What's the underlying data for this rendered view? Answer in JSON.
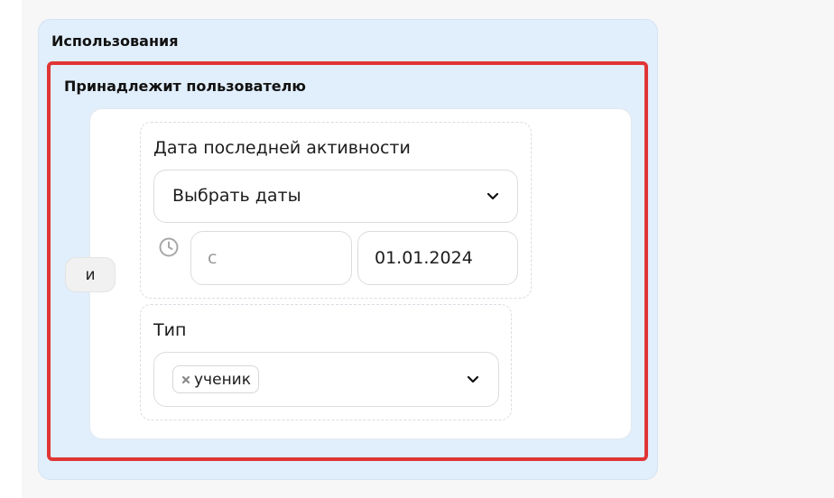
{
  "usage": {
    "title": "Использования",
    "owner_group": {
      "title": "Принадлежит пользователю",
      "operator_label": "и",
      "filters": {
        "last_activity": {
          "label": "Дата последней активности",
          "range_select": "Выбрать даты",
          "from_placeholder": "с",
          "from_value": "",
          "to_value": "01.01.2024"
        },
        "type": {
          "label": "Тип",
          "selected_tags": [
            "ученик"
          ]
        }
      }
    }
  },
  "icons": {
    "clock": "clock-icon",
    "chevron": "chevron-down-icon",
    "remove": "close-icon"
  },
  "colors": {
    "panel_bg": "#e1eefb",
    "highlight_border": "#e03535"
  }
}
